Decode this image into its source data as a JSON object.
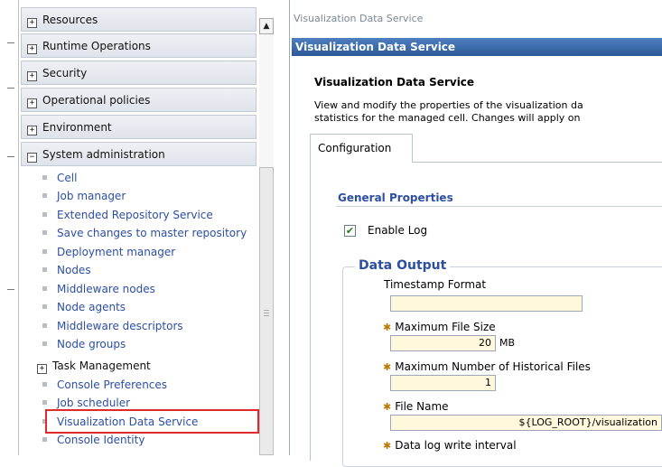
{
  "nav": {
    "categories": [
      {
        "toggle": "+",
        "label": "Resources"
      },
      {
        "toggle": "+",
        "label": "Runtime Operations"
      },
      {
        "toggle": "+",
        "label": "Security"
      },
      {
        "toggle": "+",
        "label": "Operational policies"
      },
      {
        "toggle": "+",
        "label": "Environment"
      },
      {
        "toggle": "−",
        "label": "System administration"
      }
    ],
    "system_admin_items": [
      "Cell",
      "Job manager",
      "Extended Repository Service",
      "Save changes to master repository",
      "Deployment manager",
      "Nodes",
      "Middleware nodes",
      "Node agents",
      "Middleware descriptors",
      "Node groups"
    ],
    "task_management": {
      "toggle": "+",
      "label": "Task Management"
    },
    "more_items": [
      "Console Preferences",
      "Job scheduler",
      "Visualization Data Service",
      "Console Identity"
    ],
    "scroll_up_glyph": "▲"
  },
  "content": {
    "breadcrumb": "Visualization Data Service",
    "title_bar": "Visualization Data Service",
    "page_heading": "Visualization Data Service",
    "description_line1": "View and modify the properties of the visualization da",
    "description_line2": "statistics for the managed cell. Changes will apply on",
    "tab_label": "Configuration",
    "section_title": "General Properties",
    "enable_log": {
      "label": "Enable Log",
      "checked": true,
      "glyph": "✔"
    },
    "data_output": {
      "legend": "Data Output",
      "required_marker": "✱",
      "timestamp_format": {
        "label": "Timestamp Format",
        "value": ""
      },
      "max_file_size": {
        "label": "Maximum File Size",
        "value": "20",
        "unit": "MB"
      },
      "max_historical_files": {
        "label": "Maximum Number of Historical Files",
        "value": "1"
      },
      "file_name": {
        "label": "File Name",
        "value": "${LOG_ROOT}/visualization"
      },
      "data_log_write_interval": {
        "label": "Data log write interval"
      }
    }
  }
}
